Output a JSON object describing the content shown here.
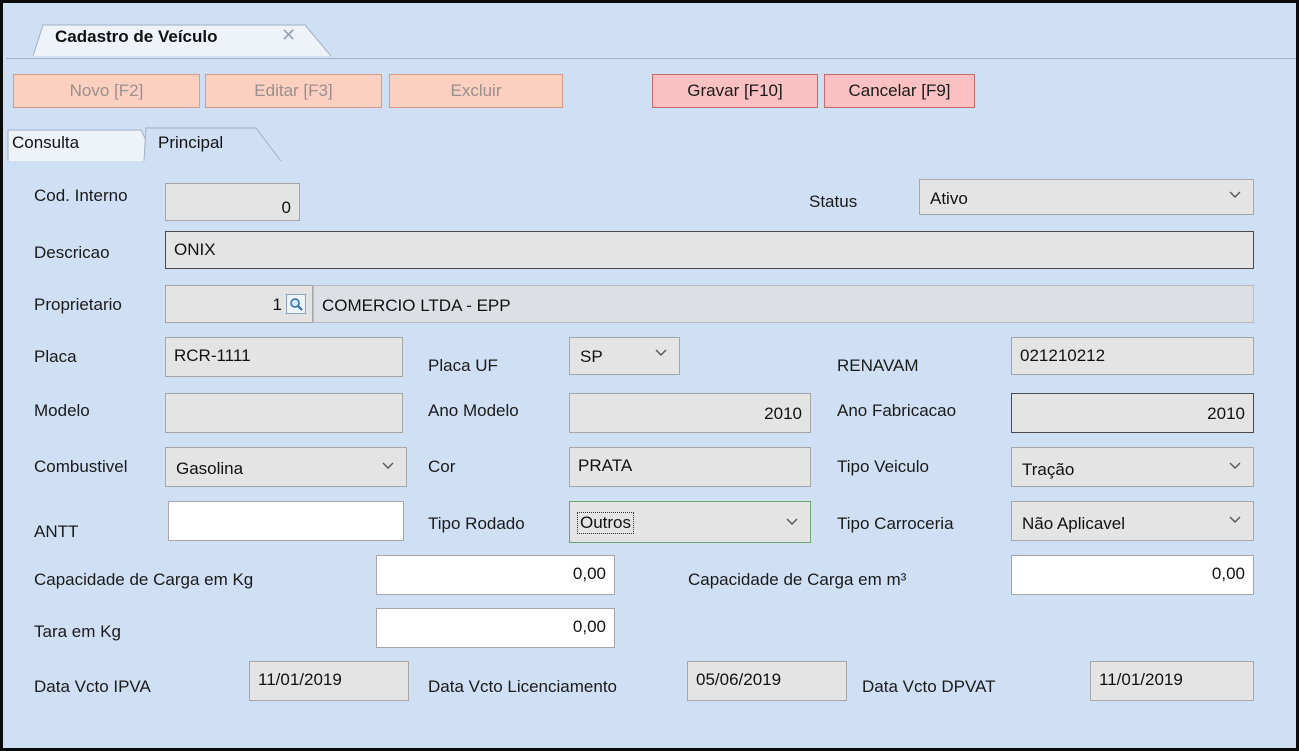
{
  "window": {
    "tab_title": "Cadastro de Veículo",
    "close_glyph": "✕"
  },
  "toolbar": {
    "novo": "Novo [F2]",
    "editar": "Editar [F3]",
    "excluir": "Excluir",
    "gravar": "Gravar [F10]",
    "cancelar": "Cancelar [F9]"
  },
  "tabs": [
    "Consulta",
    "Principal"
  ],
  "form": {
    "cod_interno": {
      "label": "Cod. Interno",
      "value": "0"
    },
    "status": {
      "label": "Status",
      "value": "Ativo"
    },
    "descricao": {
      "label": "Descricao",
      "value": "ONIX"
    },
    "proprietario": {
      "label": "Proprietario",
      "code": "1",
      "name": "COMERCIO LTDA - EPP"
    },
    "placa": {
      "label": "Placa",
      "value": "RCR-1111"
    },
    "placa_uf": {
      "label": "Placa UF",
      "value": "SP"
    },
    "renavam": {
      "label": "RENAVAM",
      "value": "021210212"
    },
    "modelo": {
      "label": "Modelo",
      "value": ""
    },
    "ano_modelo": {
      "label": "Ano Modelo",
      "value": "2010"
    },
    "ano_fabricacao": {
      "label": "Ano Fabricacao",
      "value": "2010"
    },
    "combustivel": {
      "label": "Combustivel",
      "value": "Gasolina"
    },
    "cor": {
      "label": "Cor",
      "value": "PRATA"
    },
    "tipo_veiculo": {
      "label": "Tipo Veiculo",
      "value": "Tração"
    },
    "antt": {
      "label": "ANTT",
      "value": ""
    },
    "tipo_rodado": {
      "label": "Tipo Rodado",
      "value": "Outros"
    },
    "tipo_carroceria": {
      "label": "Tipo Carroceria",
      "value": "Não Aplicavel"
    },
    "cap_kg": {
      "label": "Capacidade de Carga em Kg",
      "value": "0,00"
    },
    "cap_m3": {
      "label": "Capacidade de Carga em m³",
      "value": "0,00"
    },
    "tara": {
      "label": "Tara em Kg",
      "value": "0,00"
    },
    "ipva": {
      "label": "Data Vcto IPVA",
      "value": "11/01/2019"
    },
    "licenciamento": {
      "label": "Data Vcto Licenciamento",
      "value": "05/06/2019"
    },
    "dpvat": {
      "label": "Data Vcto DPVAT",
      "value": "11/01/2019"
    }
  },
  "colors": {
    "background": "#cfe0f4",
    "button_disabled": "#fbd0c1",
    "button_active": "#fbc1c2"
  },
  "icons": [
    "close-icon",
    "search-icon",
    "chevron-down-icon"
  ]
}
